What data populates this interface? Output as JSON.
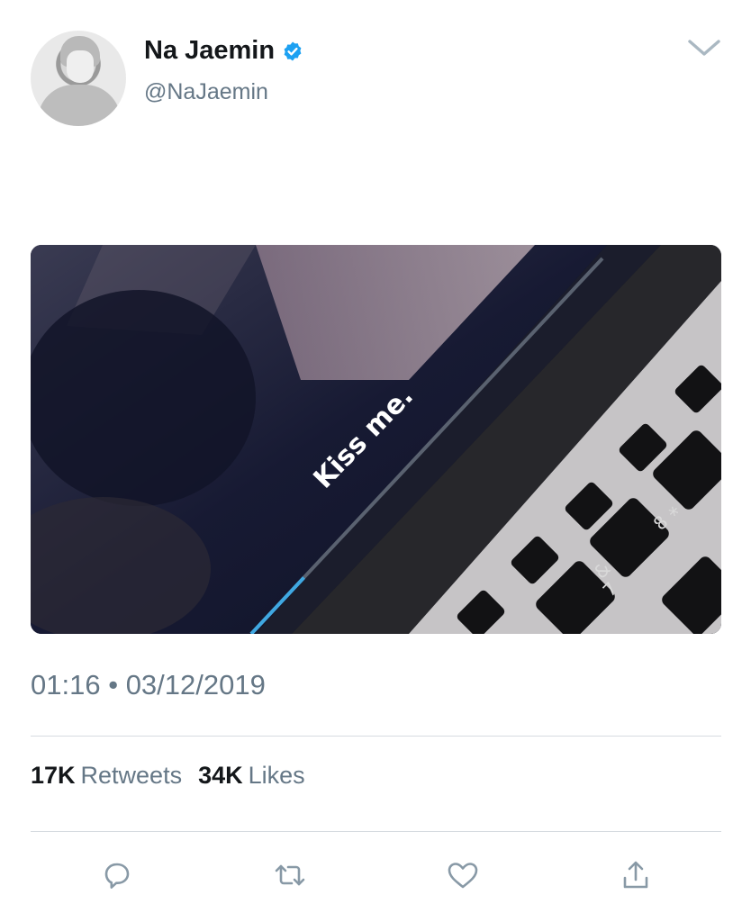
{
  "author": {
    "display_name": "Na Jaemin",
    "handle": "@NaJaemin",
    "verified": true
  },
  "media": {
    "overlay_text": "Kiss me.",
    "progress": 0.15
  },
  "timestamp": {
    "time": "01:16",
    "separator": "•",
    "date": "03/12/2019"
  },
  "stats": {
    "retweets_count": "17K",
    "retweets_label": "Retweets",
    "likes_count": "34K",
    "likes_label": "Likes"
  },
  "actions": [
    "reply-icon",
    "retweet-icon",
    "like-icon",
    "share-icon"
  ],
  "colors": {
    "text_primary": "#14171a",
    "text_secondary": "#657786",
    "verified_blue": "#1da1f2",
    "divider": "#d6dbe0"
  }
}
